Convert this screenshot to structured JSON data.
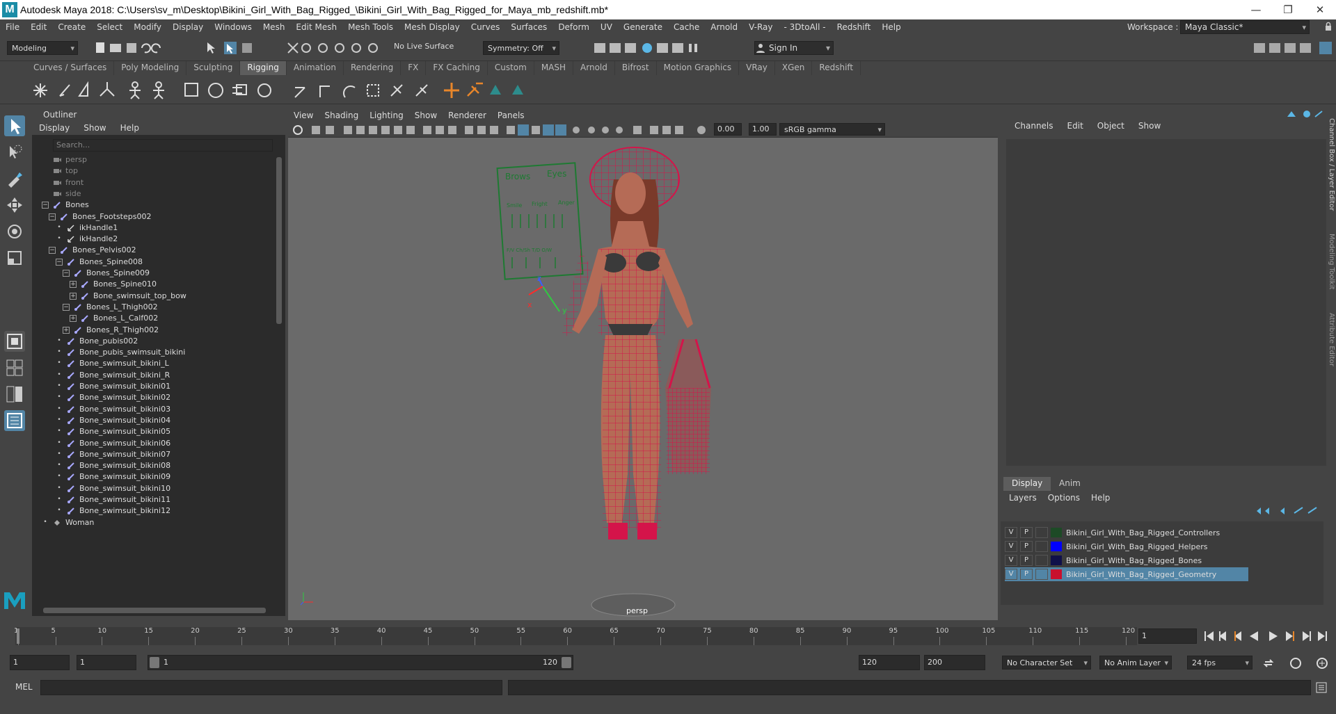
{
  "window": {
    "title": "Autodesk Maya 2018: C:\\Users\\sv_m\\Desktop\\Bikini_Girl_With_Bag_Rigged_\\Bikini_Girl_With_Bag_Rigged_for_Maya_mb_redshift.mb*",
    "minimize": "—",
    "restore": "❐",
    "close": "✕"
  },
  "menubar": [
    "File",
    "Edit",
    "Create",
    "Select",
    "Modify",
    "Display",
    "Windows",
    "Mesh",
    "Edit Mesh",
    "Mesh Tools",
    "Mesh Display",
    "Curves",
    "Surfaces",
    "Deform",
    "UV",
    "Generate",
    "Cache",
    "Arnold",
    "V-Ray",
    "- 3DtoAll -",
    "Redshift",
    "Help"
  ],
  "workspace": {
    "label": "Workspace :",
    "value": "Maya Classic*"
  },
  "status": {
    "mode": "Modeling",
    "live_surface": "No Live Surface",
    "symmetry": "Symmetry: Off",
    "sign_in": "Sign In"
  },
  "shelf_tabs": [
    "Curves / Surfaces",
    "Poly Modeling",
    "Sculpting",
    "Rigging",
    "Animation",
    "Rendering",
    "FX",
    "FX Caching",
    "Custom",
    "MASH",
    "Arnold",
    "Bifrost",
    "Motion Graphics",
    "VRay",
    "XGen",
    "Redshift"
  ],
  "active_shelf": "Rigging",
  "outliner": {
    "title": "Outliner",
    "menu": [
      "Display",
      "Show",
      "Help"
    ],
    "search_placeholder": "Search...",
    "items": [
      {
        "label": "persp",
        "level": 0,
        "kind": "cam",
        "dim": true
      },
      {
        "label": "top",
        "level": 0,
        "kind": "cam",
        "dim": true
      },
      {
        "label": "front",
        "level": 0,
        "kind": "cam",
        "dim": true
      },
      {
        "label": "side",
        "level": 0,
        "kind": "cam",
        "dim": true
      },
      {
        "label": "Bones",
        "level": 0,
        "kind": "bone",
        "exp": "−"
      },
      {
        "label": "Bones_Footsteps002",
        "level": 1,
        "kind": "bone",
        "exp": "−"
      },
      {
        "label": "ikHandle1",
        "level": 2,
        "kind": "ik",
        "exp": "•"
      },
      {
        "label": "ikHandle2",
        "level": 2,
        "kind": "ik",
        "exp": "•"
      },
      {
        "label": "Bones_Pelvis002",
        "level": 1,
        "kind": "bone",
        "exp": "−"
      },
      {
        "label": "Bones_Spine008",
        "level": 2,
        "kind": "bone",
        "exp": "−"
      },
      {
        "label": "Bones_Spine009",
        "level": 3,
        "kind": "bone",
        "exp": "−"
      },
      {
        "label": "Bones_Spine010",
        "level": 4,
        "kind": "bone",
        "exp": "+"
      },
      {
        "label": "Bone_swimsuit_top_bow",
        "level": 4,
        "kind": "bone",
        "exp": "+"
      },
      {
        "label": "Bones_L_Thigh002",
        "level": 3,
        "kind": "bone",
        "exp": "−"
      },
      {
        "label": "Bones_L_Calf002",
        "level": 4,
        "kind": "bone",
        "exp": "+"
      },
      {
        "label": "Bones_R_Thigh002",
        "level": 3,
        "kind": "bone",
        "exp": "+"
      },
      {
        "label": "Bone_pubis002",
        "level": 2,
        "kind": "bone",
        "exp": "•"
      },
      {
        "label": "Bone_pubis_swimsuit_bikini",
        "level": 2,
        "kind": "bone",
        "exp": "•"
      },
      {
        "label": "Bone_swimsuit_bikini_L",
        "level": 2,
        "kind": "bone",
        "exp": "•"
      },
      {
        "label": "Bone_swimsuit_bikini_R",
        "level": 2,
        "kind": "bone",
        "exp": "•"
      },
      {
        "label": "Bone_swimsuit_bikini01",
        "level": 2,
        "kind": "bone",
        "exp": "•"
      },
      {
        "label": "Bone_swimsuit_bikini02",
        "level": 2,
        "kind": "bone",
        "exp": "•"
      },
      {
        "label": "Bone_swimsuit_bikini03",
        "level": 2,
        "kind": "bone",
        "exp": "•"
      },
      {
        "label": "Bone_swimsuit_bikini04",
        "level": 2,
        "kind": "bone",
        "exp": "•"
      },
      {
        "label": "Bone_swimsuit_bikini05",
        "level": 2,
        "kind": "bone",
        "exp": "•"
      },
      {
        "label": "Bone_swimsuit_bikini06",
        "level": 2,
        "kind": "bone",
        "exp": "•"
      },
      {
        "label": "Bone_swimsuit_bikini07",
        "level": 2,
        "kind": "bone",
        "exp": "•"
      },
      {
        "label": "Bone_swimsuit_bikini08",
        "level": 2,
        "kind": "bone",
        "exp": "•"
      },
      {
        "label": "Bone_swimsuit_bikini09",
        "level": 2,
        "kind": "bone",
        "exp": "•"
      },
      {
        "label": "Bone_swimsuit_bikini10",
        "level": 2,
        "kind": "bone",
        "exp": "•"
      },
      {
        "label": "Bone_swimsuit_bikini11",
        "level": 2,
        "kind": "bone",
        "exp": "•"
      },
      {
        "label": "Bone_swimsuit_bikini12",
        "level": 2,
        "kind": "bone",
        "exp": "•"
      },
      {
        "label": "Woman",
        "level": 0,
        "kind": "mesh",
        "exp": "•"
      }
    ]
  },
  "viewport": {
    "menu": [
      "View",
      "Shading",
      "Lighting",
      "Show",
      "Renderer",
      "Panels"
    ],
    "exposure": "0.00",
    "gamma": "1.00",
    "color_space": "sRGB gamma",
    "camera_label": "persp",
    "ctrl_board": {
      "brows": "Brows",
      "eyes": "Eyes",
      "r": "R",
      "l": "L",
      "smile": "Smile",
      "fright": "Fright",
      "anger": "Anger",
      "mouth": "F/V    Ch/Sh    T/D    O/W"
    },
    "axis": {
      "x": "x",
      "y": "y",
      "z": "z"
    }
  },
  "channel_box": {
    "menu": [
      "Channels",
      "Edit",
      "Object",
      "Show"
    ]
  },
  "layer_editor": {
    "tabs": [
      "Display",
      "Anim"
    ],
    "menu": [
      "Layers",
      "Options",
      "Help"
    ],
    "layers": [
      {
        "v": "V",
        "p": "P",
        "name": "Bikini_Girl_With_Bag_Rigged_Controllers",
        "color": "#1d4a26",
        "selected": false
      },
      {
        "v": "V",
        "p": "P",
        "name": "Bikini_Girl_With_Bag_Rigged_Helpers",
        "color": "#0000ff",
        "selected": false
      },
      {
        "v": "V",
        "p": "P",
        "name": "Bikini_Girl_With_Bag_Rigged_Bones",
        "color": "#10104a",
        "selected": false
      },
      {
        "v": "V",
        "p": "P",
        "name": "Bikini_Girl_With_Bag_Rigged_Geometry",
        "color": "#c8102e",
        "selected": true
      }
    ]
  },
  "side_tabs": [
    "Channel Box / Layer Editor",
    "Modeling Toolkit",
    "Attribute Editor"
  ],
  "timeline": {
    "ticks": [
      "1",
      "5",
      "10",
      "15",
      "20",
      "25",
      "30",
      "35",
      "40",
      "45",
      "50",
      "55",
      "60",
      "65",
      "70",
      "75",
      "80",
      "85",
      "90",
      "95",
      "100",
      "105",
      "110",
      "115",
      "120"
    ],
    "current_frame": "1"
  },
  "range": {
    "start": "1",
    "anim_start": "1",
    "range_start": "1",
    "range_end": "120",
    "end": "120",
    "anim_end": "200",
    "char_set": "No Character Set",
    "anim_layer": "No Anim Layer",
    "fps": "24 fps"
  },
  "cmd": {
    "label": "MEL"
  }
}
